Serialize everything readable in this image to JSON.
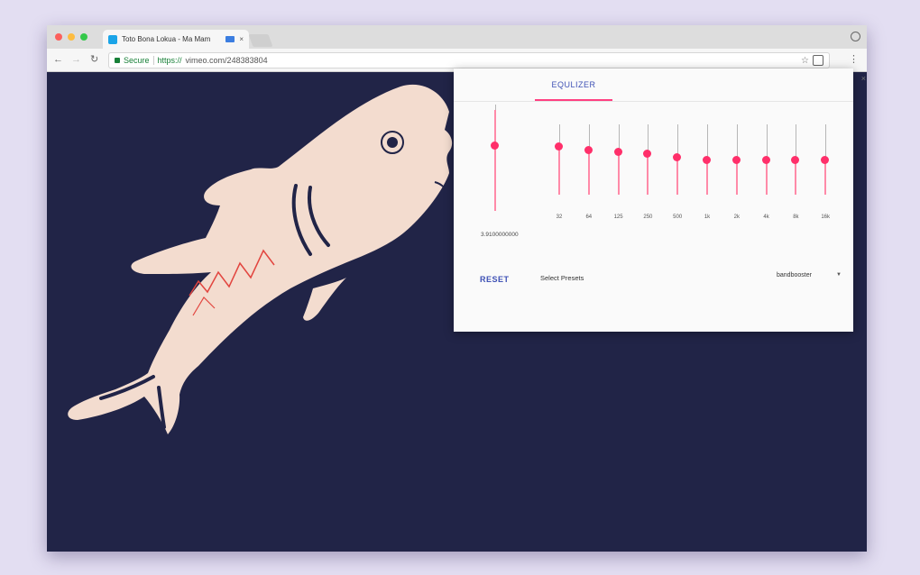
{
  "browser": {
    "tab": {
      "title": "Toto Bona Lokua - Ma Mam",
      "close": "×"
    },
    "nav": {
      "back": "←",
      "forward": "→",
      "reload": "↻"
    },
    "address": {
      "secure_label": "Secure",
      "url_scheme": "https://",
      "url_rest": "vimeo.com/248383804"
    },
    "star": "☆",
    "menu": "⋮"
  },
  "equalizer": {
    "tab_label": "EQULIZER",
    "close": "×",
    "gain": {
      "value": 0.65,
      "label": "3.9100000000"
    },
    "bands": [
      {
        "label": "32",
        "value": 0.68
      },
      {
        "label": "64",
        "value": 0.64
      },
      {
        "label": "125",
        "value": 0.61
      },
      {
        "label": "250",
        "value": 0.58
      },
      {
        "label": "500",
        "value": 0.53
      },
      {
        "label": "1k",
        "value": 0.49
      },
      {
        "label": "2k",
        "value": 0.49
      },
      {
        "label": "4k",
        "value": 0.49
      },
      {
        "label": "8k",
        "value": 0.49
      },
      {
        "label": "16k",
        "value": 0.49
      }
    ],
    "reset_label": "RESET",
    "preset_label": "Select Presets",
    "preset_value": "bandbooster",
    "preset_caret": "▼",
    "colors": {
      "accent": "#3f51b5",
      "thumb": "#ff2f6a",
      "track": "#ff8aa8"
    }
  },
  "page": {
    "background": "#212447",
    "illustration": "shark"
  }
}
